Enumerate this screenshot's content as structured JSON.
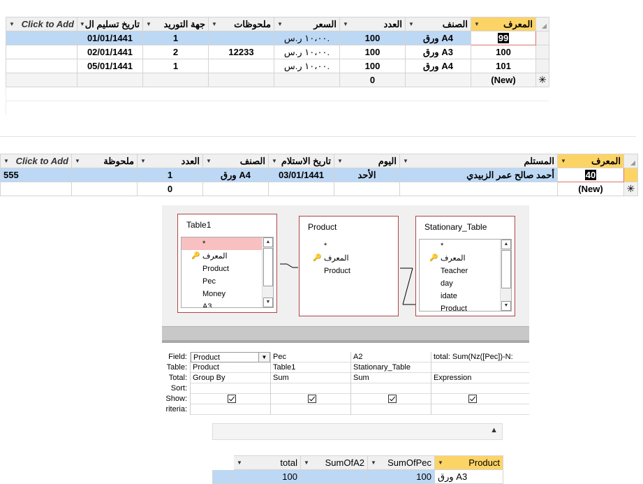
{
  "table1": {
    "headers": [
      "المعرف",
      "الصنف",
      "العدد",
      "السعر",
      "ملحوظات",
      "جهة التوريد",
      "تاريخ تسليم ال",
      "Click to Add"
    ],
    "rows": [
      [
        "99",
        "ورق A4",
        "100",
        "١٠،٠٠ ر.س.",
        "",
        "1",
        "01/01/1441"
      ],
      [
        "100",
        "ورق A3",
        "100",
        "١٠،٠٠ ر.س.",
        "12233",
        "2",
        "02/01/1441"
      ],
      [
        "101",
        "ورق A4",
        "100",
        "١٠،٠٠ ر.س.",
        "",
        "1",
        "05/01/1441"
      ]
    ],
    "new_row": {
      "id": "(New)",
      "count": "0"
    }
  },
  "stationary": {
    "headers": [
      "المعرف",
      "المستلم",
      "اليوم",
      "تاريخ الاستلام",
      "الصنف",
      "العدد",
      "ملحوظة",
      "Click to Add"
    ],
    "rows": [
      [
        "40",
        "أحمد صالح عمر الزبيدي",
        "الأحد",
        "03/01/1441",
        "ورق A4",
        "1",
        "555"
      ]
    ],
    "new_row": {
      "id": "(New)",
      "count": "0"
    }
  },
  "designer": {
    "tables": [
      {
        "title": "Table1",
        "fields": [
          "*",
          "المعرف",
          "Product",
          "Pec",
          "Money",
          "A3"
        ]
      },
      {
        "title": "Product",
        "fields": [
          "*",
          "المعرف",
          "Product"
        ]
      },
      {
        "title": "Stationary_Table",
        "fields": [
          "*",
          "المعرف",
          "Teacher",
          "day",
          "idate",
          "Product"
        ]
      }
    ]
  },
  "qbe": {
    "labels": [
      "Field:",
      "Table:",
      "Total:",
      "Sort:",
      "Show:",
      "riteria:"
    ],
    "columns": [
      {
        "field": "Product",
        "table": "Product",
        "total": "Group By"
      },
      {
        "field": "Pec",
        "table": "Table1",
        "total": "Sum"
      },
      {
        "field": "A2",
        "table": "Stationary_Table",
        "total": "Sum"
      },
      {
        "field": "total: Sum(Nz([Pec])-N:",
        "table": "",
        "total": "Expression"
      }
    ]
  },
  "results": {
    "headers": [
      "total",
      "SumOfA2",
      "SumOfPec",
      "Product"
    ],
    "row": [
      "100",
      "",
      "100",
      "ورق A3"
    ]
  },
  "colors": {
    "selected_header": "#fcd466",
    "selected_row": "#bcd8f5",
    "designer_bg": "#f0f0f0",
    "table_border": "#b04545"
  }
}
